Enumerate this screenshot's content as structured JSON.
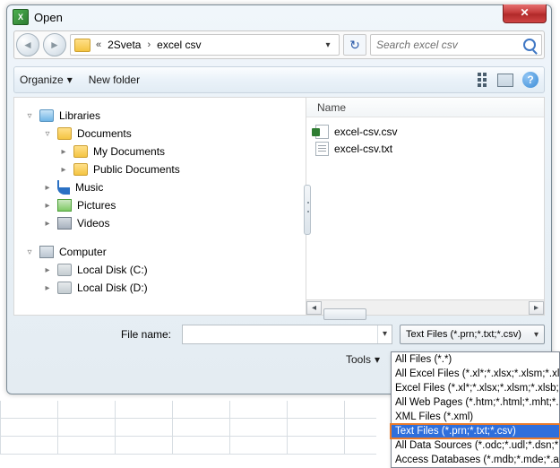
{
  "window": {
    "title": "Open",
    "close_glyph": "✕"
  },
  "breadcrumb": {
    "prefix": "«",
    "items": [
      "2Sveta",
      "excel csv"
    ],
    "separator": "›"
  },
  "search": {
    "placeholder": "Search excel csv"
  },
  "cmdrow": {
    "organize": "Organize",
    "organize_glyph": "▾",
    "newfolder": "New folder",
    "help_glyph": "?"
  },
  "tree": {
    "libraries": "Libraries",
    "documents": "Documents",
    "my_documents": "My Documents",
    "public_documents": "Public Documents",
    "music": "Music",
    "pictures": "Pictures",
    "videos": "Videos",
    "computer": "Computer",
    "disk_c": "Local Disk (C:)",
    "disk_d": "Local Disk (D:)"
  },
  "list": {
    "column_name": "Name",
    "files": [
      {
        "name": "excel-csv.csv",
        "icon": "csv"
      },
      {
        "name": "excel-csv.txt",
        "icon": "txt"
      }
    ]
  },
  "bottom": {
    "filename_label": "File name:",
    "filename_value": "",
    "filter_selected": "Text Files (*.prn;*.txt;*.csv)",
    "tools_label": "Tools",
    "tools_glyph": "▾"
  },
  "filter_options": [
    "All Files (*.*)",
    "All Excel Files (*.xl*;*.xlsx;*.xlsm;*.xlsb;*.xl",
    "Excel Files (*.xl*;*.xlsx;*.xlsm;*.xlsb;*.xlam",
    "All Web Pages (*.htm;*.html;*.mht;*.mh",
    "XML Files (*.xml)",
    "Text Files (*.prn;*.txt;*.csv)",
    "All Data Sources (*.odc;*.udl;*.dsn;*.mdb",
    "Access Databases (*.mdb;*.mde;*.accdb"
  ],
  "filter_selected_index": 5
}
